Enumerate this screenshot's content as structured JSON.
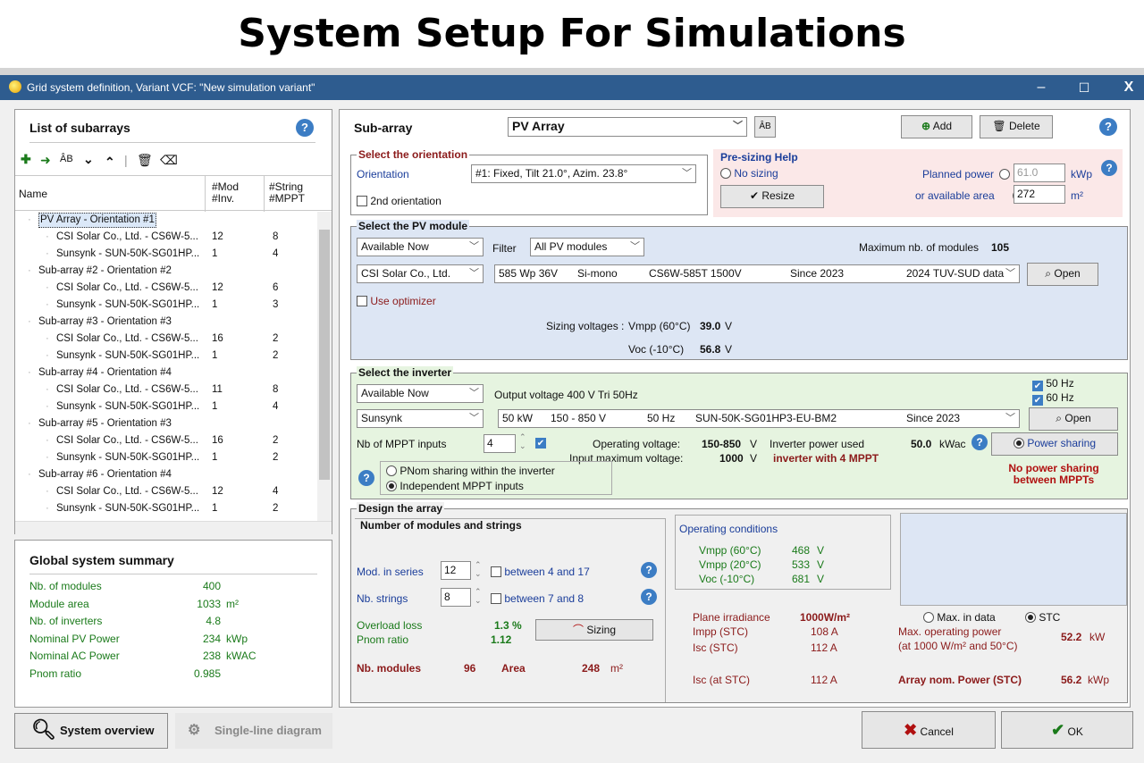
{
  "banner": {
    "title": "System Setup For Simulations"
  },
  "window": {
    "title": "Grid system definition, Variant VCF:  \"New simulation variant\"",
    "min": "–",
    "max": "☐",
    "close": "X"
  },
  "left": {
    "title": "List of subarrays",
    "cols": {
      "name": "Name",
      "mod": "#Mod\n#Inv.",
      "str": "#String\n#MPPT"
    },
    "rows": [
      {
        "name": "PV Array - Orientation #1",
        "mod": "",
        "str": "",
        "lvl": 0,
        "sel": true
      },
      {
        "name": "CSI Solar Co., Ltd. - CS6W-5...",
        "mod": "12",
        "str": "8",
        "lvl": 1
      },
      {
        "name": "Sunsynk - SUN-50K-SG01HP...",
        "mod": "1",
        "str": "4",
        "lvl": 1
      },
      {
        "name": "Sub-array #2 - Orientation #2",
        "mod": "",
        "str": "",
        "lvl": 0
      },
      {
        "name": "CSI Solar Co., Ltd. - CS6W-5...",
        "mod": "12",
        "str": "6",
        "lvl": 1
      },
      {
        "name": "Sunsynk - SUN-50K-SG01HP...",
        "mod": "1",
        "str": "3",
        "lvl": 1
      },
      {
        "name": "Sub-array #3 - Orientation #3",
        "mod": "",
        "str": "",
        "lvl": 0
      },
      {
        "name": "CSI Solar Co., Ltd. - CS6W-5...",
        "mod": "16",
        "str": "2",
        "lvl": 1
      },
      {
        "name": "Sunsynk - SUN-50K-SG01HP...",
        "mod": "1",
        "str": "2",
        "lvl": 1
      },
      {
        "name": "Sub-array #4 - Orientation #4",
        "mod": "",
        "str": "",
        "lvl": 0
      },
      {
        "name": "CSI Solar Co., Ltd. - CS6W-5...",
        "mod": "11",
        "str": "8",
        "lvl": 1
      },
      {
        "name": "Sunsynk - SUN-50K-SG01HP...",
        "mod": "1",
        "str": "4",
        "lvl": 1
      },
      {
        "name": "Sub-array #5 - Orientation #3",
        "mod": "",
        "str": "",
        "lvl": 0
      },
      {
        "name": "CSI Solar Co., Ltd. - CS6W-5...",
        "mod": "16",
        "str": "2",
        "lvl": 1
      },
      {
        "name": "Sunsynk - SUN-50K-SG01HP...",
        "mod": "1",
        "str": "2",
        "lvl": 1
      },
      {
        "name": "Sub-array #6 - Orientation #4",
        "mod": "",
        "str": "",
        "lvl": 0
      },
      {
        "name": "CSI Solar Co., Ltd. - CS6W-5...",
        "mod": "12",
        "str": "4",
        "lvl": 1
      },
      {
        "name": "Sunsynk - SUN-50K-SG01HP...",
        "mod": "1",
        "str": "2",
        "lvl": 1
      }
    ],
    "summary": {
      "title": "Global system summary",
      "rows": [
        {
          "label": "Nb. of modules",
          "value": "400",
          "unit": ""
        },
        {
          "label": "Module area",
          "value": "1033",
          "unit": "m²"
        },
        {
          "label": "Nb. of inverters",
          "value": "4.8",
          "unit": ""
        },
        {
          "label": "Nominal PV Power",
          "value": "234",
          "unit": "kWp"
        },
        {
          "label": "Nominal AC Power",
          "value": "238",
          "unit": "kWAC"
        },
        {
          "label": "Pnom ratio",
          "value": "0.985",
          "unit": ""
        }
      ]
    }
  },
  "bottom": {
    "overview": "System overview",
    "single": "Single-line diagram",
    "cancel": "Cancel",
    "ok": "OK"
  },
  "subarray": {
    "label": "Sub-array",
    "name": "PV Array",
    "add": "Add",
    "delete": "Delete"
  },
  "orientation": {
    "title": "Select the orientation",
    "label": "Orientation",
    "value": "#1: Fixed, Tilt 21.0°, Azim. 23.8°",
    "second": "2nd orientation"
  },
  "presizing": {
    "title": "Pre-sizing Help",
    "nosizing": "No sizing",
    "resize": "Resize",
    "planned": "Planned power",
    "planned_val": "61.0",
    "planned_unit": "kWp",
    "area": "or available area",
    "area_val": "272",
    "area_unit": "m²"
  },
  "pvmodule": {
    "title": "Select the PV module",
    "avail": "Available Now",
    "filter": "Filter",
    "filter_val": "All PV modules",
    "maxnb": "Maximum nb. of modules",
    "maxnb_val": "105",
    "maker": "CSI Solar Co., Ltd.",
    "spec_pw": "585 Wp 36V",
    "spec_type": "Si-mono",
    "spec_model": "CS6W-585T 1500V",
    "spec_since": "Since 2023",
    "spec_src": "2024 TUV-SUD data",
    "open": "Open",
    "optimizer": "Use optimizer",
    "sizing": "Sizing voltages :",
    "vmpp_lbl": "Vmpp (60°C)",
    "vmpp": "39.0",
    "voc_lbl": "Voc (-10°C)",
    "voc": "56.8",
    "v": "V"
  },
  "inverter": {
    "title": "Select the inverter",
    "avail": "Available Now",
    "output": "Output voltage 400 V Tri 50Hz",
    "hz50": "50 Hz",
    "hz60": "60 Hz",
    "maker": "Sunsynk",
    "spec_kw": "50 kW",
    "spec_v": "150 - 850 V",
    "spec_hz": "50 Hz",
    "spec_model": "SUN-50K-SG01HP3-EU-BM2",
    "spec_since": "Since 2023",
    "open": "Open",
    "mppt_lbl": "Nb of MPPT inputs",
    "mppt": "4",
    "opv_lbl": "Operating voltage:",
    "opv": "150-850",
    "opv_u": "V",
    "maxv_lbl": "Input maximum voltage:",
    "maxv": "1000",
    "maxv_u": "V",
    "used_lbl": "Inverter power used",
    "used": "50.0",
    "used_u": "kWac",
    "with": "inverter with 4 MPPT",
    "share_btn": "Power sharing",
    "noshare": "No power sharing\nbetween MPPTs",
    "pnom_share": "PNom sharing within the inverter",
    "indep": "Independent MPPT inputs"
  },
  "design": {
    "title": "Design the array",
    "sub": "Number of modules and strings",
    "series_lbl": "Mod. in series",
    "series": "12",
    "series_rng": "between 4 and 17",
    "strings_lbl": "Nb. strings",
    "strings": "8",
    "strings_rng": "between 7 and 8",
    "overload_lbl": "Overload loss",
    "overload": "1.3 %",
    "pnom_lbl": "Pnom ratio",
    "pnom": "1.12",
    "sizing": "Sizing",
    "nbmod_lbl": "Nb. modules",
    "nbmod": "96",
    "area_lbl": "Area",
    "area": "248",
    "area_u": "m²",
    "opcond": "Operating conditions",
    "c1l": "Vmpp (60°C)",
    "c1": "468",
    "c2l": "Vmpp (20°C)",
    "c2": "533",
    "c3l": "Voc (-10°C)",
    "c3": "681",
    "cu": "V",
    "irr_lbl": "Plane irradiance",
    "irr": "1000W/m²",
    "maxdata": "Max. in data",
    "stc": "STC",
    "impp_lbl": "Impp (STC)",
    "impp": "108 A",
    "isc_lbl": "Isc (STC)",
    "isc": "112 A",
    "iscat_lbl": "Isc (at STC)",
    "iscat": "112 A",
    "maxop_lbl": "Max. operating power",
    "maxop_sub": "(at 1000 W/m² and 50°C)",
    "maxop": "52.2",
    "kw": "kW",
    "nom_lbl": "Array nom. Power (STC)",
    "nom": "56.2",
    "kwp": "kWp"
  }
}
